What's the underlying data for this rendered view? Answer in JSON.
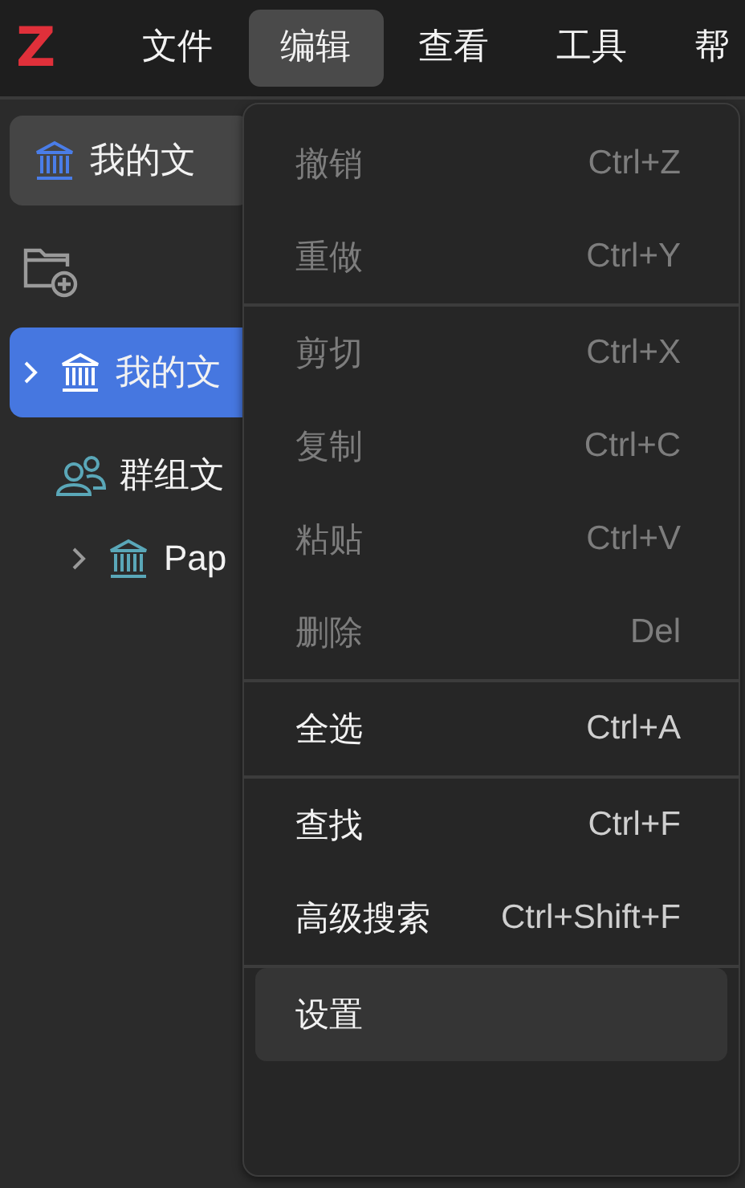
{
  "logo": "Z",
  "menubar": {
    "items": [
      {
        "label": "文件",
        "selected": false
      },
      {
        "label": "编辑",
        "selected": true
      },
      {
        "label": "查看",
        "selected": false
      },
      {
        "label": "工具",
        "selected": false
      },
      {
        "label": "帮",
        "selected": false
      }
    ]
  },
  "sidebar": {
    "library_button": "我的文",
    "tree": [
      {
        "kind": "library",
        "label": "我的文",
        "selected": true,
        "expanded": false
      },
      {
        "kind": "group",
        "label": "群组文",
        "selected": false,
        "children": [
          {
            "label": "Pap",
            "selected": false,
            "expanded": false
          }
        ]
      }
    ]
  },
  "menu": {
    "groups": [
      [
        {
          "label": "撤销",
          "shortcut": "Ctrl+Z",
          "disabled": true,
          "selected": false
        },
        {
          "label": "重做",
          "shortcut": "Ctrl+Y",
          "disabled": true,
          "selected": false
        }
      ],
      [
        {
          "label": "剪切",
          "shortcut": "Ctrl+X",
          "disabled": true,
          "selected": false
        },
        {
          "label": "复制",
          "shortcut": "Ctrl+C",
          "disabled": true,
          "selected": false
        },
        {
          "label": "粘贴",
          "shortcut": "Ctrl+V",
          "disabled": true,
          "selected": false
        },
        {
          "label": "删除",
          "shortcut": "Del",
          "disabled": true,
          "selected": false
        }
      ],
      [
        {
          "label": "全选",
          "shortcut": "Ctrl+A",
          "disabled": false,
          "selected": false
        }
      ],
      [
        {
          "label": "查找",
          "shortcut": "Ctrl+F",
          "disabled": false,
          "selected": false
        },
        {
          "label": "高级搜索",
          "shortcut": "Ctrl+Shift+F",
          "disabled": false,
          "selected": false
        }
      ],
      [
        {
          "label": "设置",
          "disabled": false,
          "selected": true
        }
      ]
    ]
  }
}
